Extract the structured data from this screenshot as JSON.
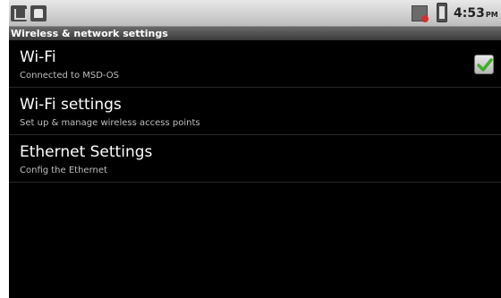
{
  "status_bar": {
    "time": "4:53",
    "ampm": "PM",
    "icons": [
      "usb-icon",
      "sd-card-icon",
      "network-icon",
      "battery-icon"
    ]
  },
  "header": {
    "title": "Wireless & network settings"
  },
  "settings": {
    "items": [
      {
        "title": "Wi-Fi",
        "summary": "Connected to MSD-OS",
        "checked": true
      },
      {
        "title": "Wi-Fi settings",
        "summary": "Set up & manage wireless access points"
      },
      {
        "title": "Ethernet Settings",
        "summary": "Config the Ethernet"
      }
    ]
  },
  "colors": {
    "background": "#000000",
    "checkbox_check": "#3fae2a"
  }
}
